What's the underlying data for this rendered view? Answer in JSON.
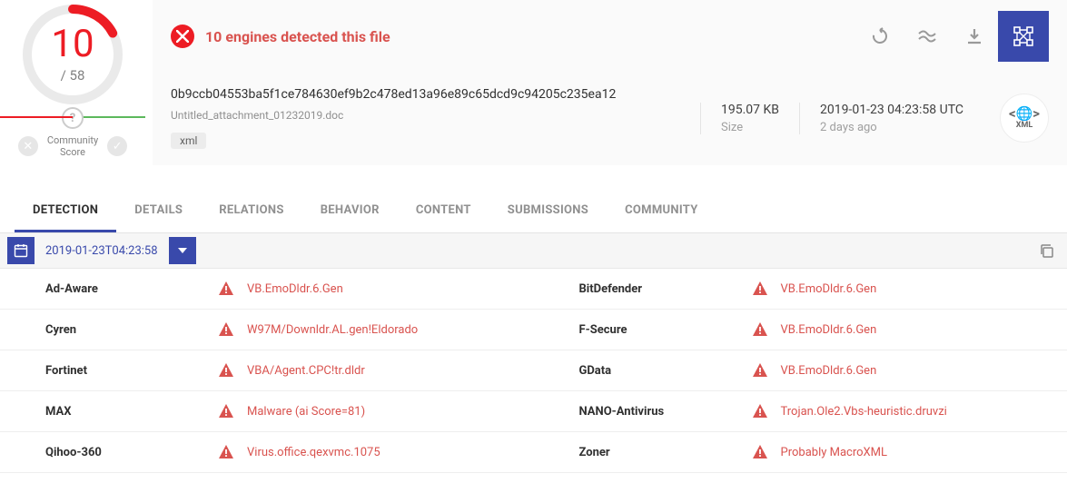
{
  "score": {
    "value": "10",
    "denom": "/ 58"
  },
  "community": {
    "label": "Community\nScore"
  },
  "banner": {
    "text": "10 engines detected this file"
  },
  "meta": {
    "hash": "0b9ccb04553ba5f1ce784630ef9b2c478ed13a96e89c65dcd9c94205c235ea12",
    "filename": "Untitled_attachment_01232019.doc",
    "tag": "xml",
    "size_val": "195.07 KB",
    "size_lbl": "Size",
    "time_val": "2019-01-23 04:23:58 UTC",
    "time_lbl": "2 days ago",
    "filetype_text": "XML"
  },
  "tabs": [
    "DETECTION",
    "DETAILS",
    "RELATIONS",
    "BEHAVIOR",
    "CONTENT",
    "SUBMISSIONS",
    "COMMUNITY"
  ],
  "toolbar": {
    "date": "2019-01-23T04:23:58"
  },
  "results": [
    {
      "v": "Ad-Aware",
      "r": "VB.EmoDldr.6.Gen",
      "v2": "BitDefender",
      "r2": "VB.EmoDldr.6.Gen"
    },
    {
      "v": "Cyren",
      "r": "W97M/Downldr.AL.gen!Eldorado",
      "v2": "F-Secure",
      "r2": "VB.EmoDldr.6.Gen"
    },
    {
      "v": "Fortinet",
      "r": "VBA/Agent.CPC!tr.dldr",
      "v2": "GData",
      "r2": "VB.EmoDldr.6.Gen"
    },
    {
      "v": "MAX",
      "r": "Malware (ai Score=81)",
      "v2": "NANO-Antivirus",
      "r2": "Trojan.Ole2.Vbs-heuristic.druvzi"
    },
    {
      "v": "Qihoo-360",
      "r": "Virus.office.qexvmc.1075",
      "v2": "Zoner",
      "r2": "Probably MacroXML"
    }
  ]
}
